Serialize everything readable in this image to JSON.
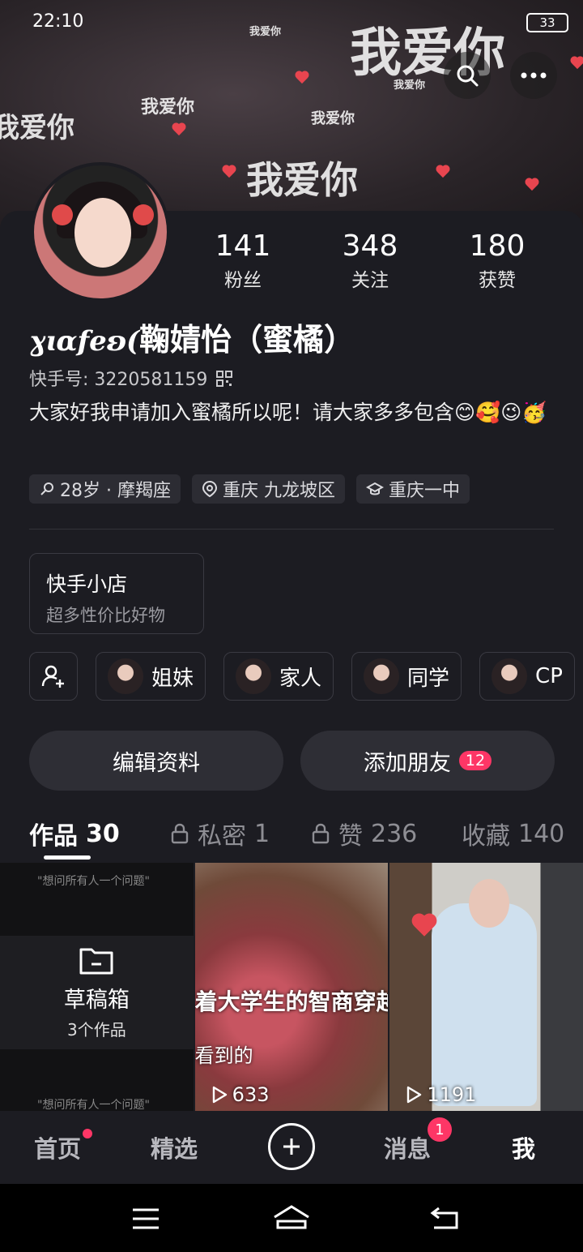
{
  "status": {
    "time": "22:10",
    "battery": "33"
  },
  "cover": {
    "words": [
      "我爱你",
      "我爱你",
      "我爱你",
      "我爱你",
      "我爱你",
      "我爱你",
      "我爱你"
    ]
  },
  "profile": {
    "stats": [
      {
        "num": "141",
        "label": "粉丝"
      },
      {
        "num": "348",
        "label": "关注"
      },
      {
        "num": "180",
        "label": "获赞"
      }
    ],
    "name_script": "ɣɩɑfeʚ(",
    "name": "鞠婧怡（蜜橘）",
    "kuaishou_id": "快手号: 3220581159",
    "bio": "大家好我申请加入蜜橘所以呢！请大家多多包含😊🥰😉🥳",
    "tags": [
      {
        "icon": "gender-female-icon",
        "text": "28岁 · 摩羯座"
      },
      {
        "icon": "location-pin-icon",
        "text": "重庆 九龙坡区"
      },
      {
        "icon": "school-cap-icon",
        "text": "重庆一中"
      }
    ]
  },
  "shop": {
    "title": "快手小店",
    "subtitle": "超多性价比好物"
  },
  "groups": [
    "姐妹",
    "家人",
    "同学",
    "CP"
  ],
  "actions": {
    "edit": "编辑资料",
    "add_friend": "添加朋友",
    "add_friend_badge": "12"
  },
  "tabs": [
    {
      "label": "作品",
      "count": "30",
      "locked": false
    },
    {
      "label": "私密",
      "count": "1",
      "locked": true
    },
    {
      "label": "赞",
      "count": "236",
      "locked": true
    },
    {
      "label": "收藏",
      "count": "140",
      "locked": false
    }
  ],
  "grid": {
    "draft_title": "草稿箱",
    "draft_sub": "3个作品",
    "draft_caption": "\"想问所有人一个问题\"",
    "video2_overlay": "着大学生的智商穿越到",
    "video2_overlay2": "看到的",
    "video2_plays": "633",
    "video3_plays": "1191"
  },
  "nav": {
    "home": "首页",
    "featured": "精选",
    "messages": "消息",
    "messages_badge": "1",
    "me": "我"
  },
  "colors": {
    "accent": "#fe3666",
    "panel": "#1c1c22",
    "chip": "#2c2c33"
  }
}
